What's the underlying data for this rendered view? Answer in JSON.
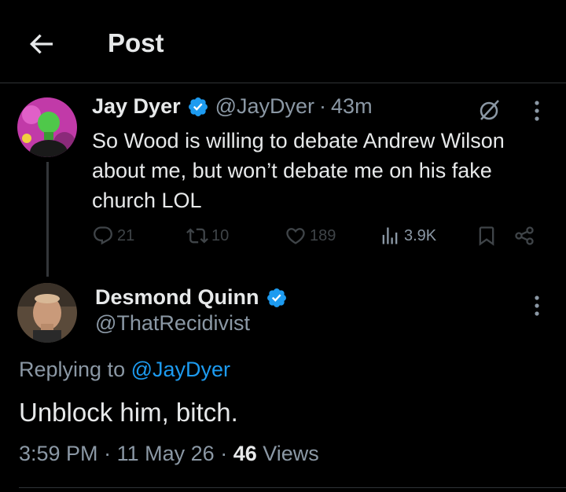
{
  "header": {
    "title": "Post",
    "back_icon": "arrow-left-icon"
  },
  "tweet1": {
    "name": "Jay Dyer",
    "handle": "@JayDyer",
    "separator": "·",
    "time": "43m",
    "text": "So Wood is willing to debate Andrew Wilson about me, but won’t debate me on his fake church LOL",
    "stats": {
      "replies": "21",
      "retweets": "10",
      "likes": "189",
      "views": "3.9K"
    }
  },
  "tweet2": {
    "name": "Desmond Quinn",
    "handle": "@ThatRecidivist",
    "replying_prefix": "Replying to",
    "replying_to": "@JayDyer",
    "text": "Unblock him, bitch.",
    "timestamp": "3:59 PM",
    "separator": "·",
    "date": "11 May 26",
    "separator2": "·",
    "views_count": "46",
    "views_label": "Views"
  },
  "colors": {
    "background": "#000000",
    "text": "#e7e9ea",
    "muted": "#8b98a5",
    "accent": "#1d9bf0",
    "divider": "#2f3336"
  }
}
